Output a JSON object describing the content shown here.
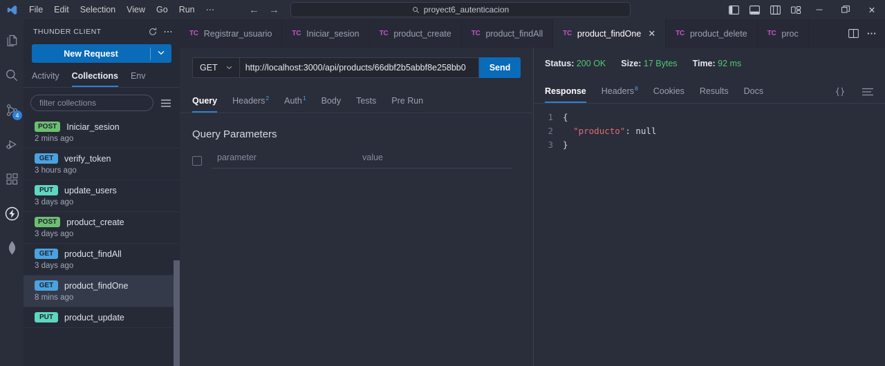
{
  "titlebar": {
    "menu_items": [
      "File",
      "Edit",
      "Selection",
      "View",
      "Go",
      "Run",
      "⋯"
    ],
    "back_arrow": "←",
    "forward_arrow": "→",
    "search_text": "proyect6_autenticacion",
    "search_icon": "search-icon",
    "layout_icons": [
      "toggle-primary-sidebar-icon",
      "toggle-panel-icon",
      "toggle-secondary-sidebar-icon",
      "customize-layout-icon"
    ],
    "window_controls": {
      "minimize": "─",
      "restore": "❐",
      "close": "✕"
    }
  },
  "activitybar": {
    "items": [
      {
        "name": "explorer-icon",
        "badge": ""
      },
      {
        "name": "search-icon",
        "badge": ""
      },
      {
        "name": "source-control-icon",
        "badge": "4"
      },
      {
        "name": "run-and-debug-icon",
        "badge": ""
      },
      {
        "name": "extensions-icon",
        "badge": ""
      },
      {
        "name": "thunder-client-icon",
        "badge": ""
      },
      {
        "name": "mongodb-icon",
        "badge": ""
      }
    ]
  },
  "sidebar": {
    "header_title": "THUNDER CLIENT",
    "refresh_icon": "refresh-icon",
    "more_icon": "more-actions-icon",
    "new_request_label": "New Request",
    "new_request_caret": "⌄",
    "tabs": [
      {
        "label": "Activity",
        "active": false
      },
      {
        "label": "Collections",
        "active": true
      },
      {
        "label": "Env",
        "active": false
      }
    ],
    "filter_placeholder": "filter collections",
    "filter_menu_icon": "menu-icon",
    "collections": [
      {
        "method": "POST",
        "name": "Iniciar_sesion",
        "time": "2 mins ago",
        "selected": false
      },
      {
        "method": "GET",
        "name": "verify_token",
        "time": "3 hours ago",
        "selected": false
      },
      {
        "method": "PUT",
        "name": "update_users",
        "time": "3 days ago",
        "selected": false
      },
      {
        "method": "POST",
        "name": "product_create",
        "time": "3 days ago",
        "selected": false
      },
      {
        "method": "GET",
        "name": "product_findAll",
        "time": "3 days ago",
        "selected": false
      },
      {
        "method": "GET",
        "name": "product_findOne",
        "time": "8 mins ago",
        "selected": true
      },
      {
        "method": "PUT",
        "name": "product_update",
        "time": "",
        "selected": false
      }
    ]
  },
  "tabbar": {
    "tabs": [
      {
        "label": "Registrar_usuario",
        "active": false,
        "closable": false
      },
      {
        "label": "Iniciar_sesion",
        "active": false,
        "closable": false
      },
      {
        "label": "product_create",
        "active": false,
        "closable": false
      },
      {
        "label": "product_findAll",
        "active": false,
        "closable": false
      },
      {
        "label": "product_findOne",
        "active": true,
        "closable": true
      },
      {
        "label": "product_delete",
        "active": false,
        "closable": false
      },
      {
        "label": "proc",
        "active": false,
        "closable": false
      }
    ],
    "tab_icon_label": "TC",
    "close_glyph": "✕",
    "split_editor_icon": "split-editor-icon",
    "more_icon": "more-actions-icon"
  },
  "request": {
    "method": "GET",
    "method_caret": "⌄",
    "url": "http://localhost:3000/api/products/66dbf2b5abbf8e258bb0",
    "send_label": "Send",
    "tabs": [
      {
        "label": "Query",
        "badge": "",
        "active": true
      },
      {
        "label": "Headers",
        "badge": "2",
        "active": false
      },
      {
        "label": "Auth",
        "badge": "1",
        "active": false
      },
      {
        "label": "Body",
        "badge": "",
        "active": false
      },
      {
        "label": "Tests",
        "badge": "",
        "active": false
      },
      {
        "label": "Pre Run",
        "badge": "",
        "active": false
      }
    ],
    "query_params_title": "Query Parameters",
    "param_placeholder": "parameter",
    "value_placeholder": "value"
  },
  "response": {
    "status_label": "Status:",
    "status_value": "200 OK",
    "size_label": "Size:",
    "size_value": "17 Bytes",
    "time_label": "Time:",
    "time_value": "92 ms",
    "tabs": [
      {
        "label": "Response",
        "badge": "",
        "active": true
      },
      {
        "label": "Headers",
        "badge": "8",
        "active": false
      },
      {
        "label": "Cookies",
        "badge": "",
        "active": false
      },
      {
        "label": "Results",
        "badge": "",
        "active": false
      },
      {
        "label": "Docs",
        "badge": "",
        "active": false
      }
    ],
    "format_icon": "format-json-icon",
    "wrap_icon": "wrap-lines-icon",
    "body_lines": [
      {
        "n": "1",
        "indent": "",
        "key": "",
        "text": "{"
      },
      {
        "n": "2",
        "indent": "  ",
        "key": "\"producto\"",
        "text": ": null"
      },
      {
        "n": "3",
        "indent": "",
        "key": "",
        "text": "}"
      }
    ]
  },
  "colors": {
    "accent_blue": "#0a6bb8",
    "tab_underline": "#2f81d6",
    "status_green": "#4ec978",
    "method_get": "#4aa3df",
    "method_post": "#6cbf70",
    "method_put": "#5fd6c0",
    "tc_magenta": "#c653c6",
    "json_key_red": "#e06c75"
  }
}
